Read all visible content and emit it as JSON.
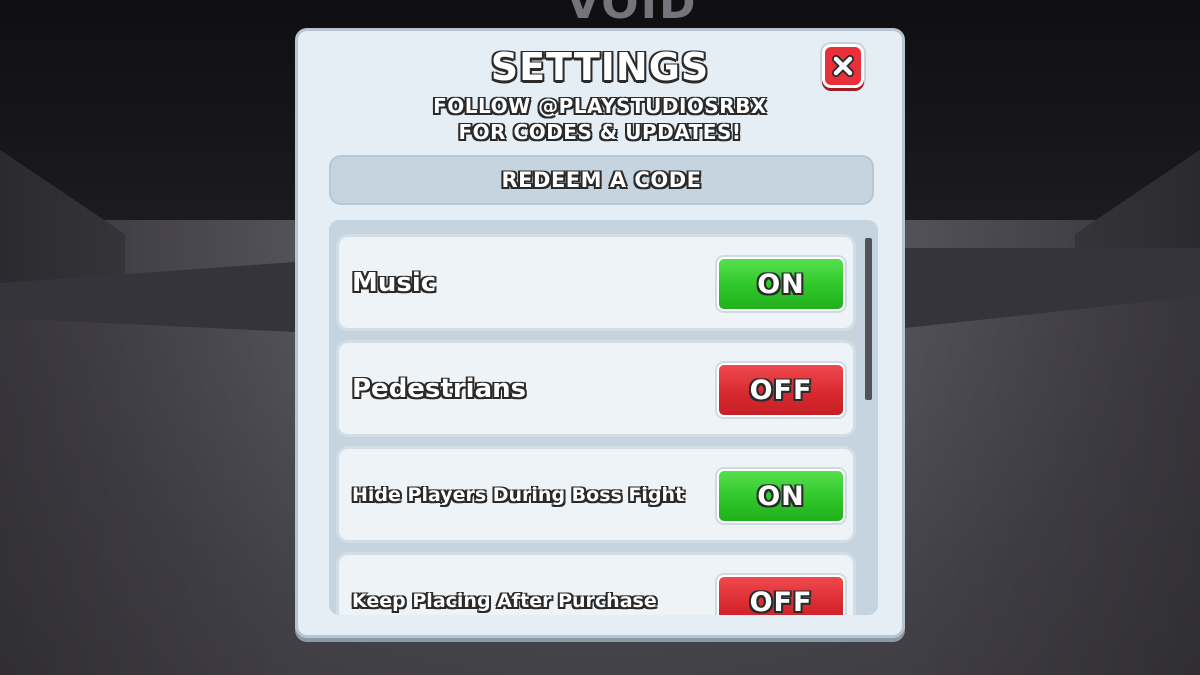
{
  "scene": {
    "sign_text": "VOID"
  },
  "modal": {
    "title": "SETTINGS",
    "subtitle_line1": "FOLLOW @PLAYSTUDIOSRBX",
    "subtitle_line2": "FOR CODES & UPDATES!",
    "close_icon": "close-x-icon",
    "redeem_label": "REDEEM A CODE"
  },
  "settings": [
    {
      "label": "Music",
      "state": "ON"
    },
    {
      "label": "Pedestrians",
      "state": "OFF"
    },
    {
      "label": "Hide Players During Boss Fight",
      "state": "ON"
    },
    {
      "label": "Keep Placing After Purchase",
      "state": "OFF"
    }
  ],
  "colors": {
    "on": "#2fc629",
    "off": "#d92a30",
    "close": "#e8303a",
    "panel": "#e5eef4"
  },
  "scroll": {
    "position": 0.0
  }
}
